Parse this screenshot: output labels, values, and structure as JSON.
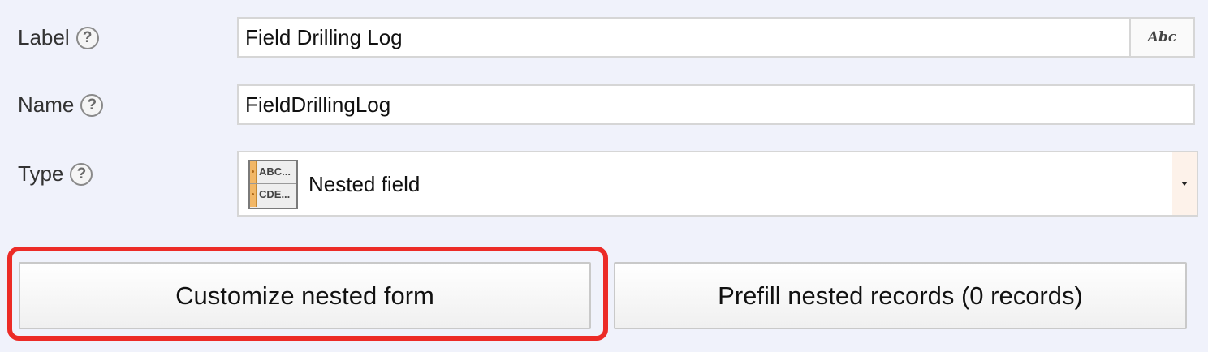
{
  "fields": {
    "label": {
      "caption": "Label",
      "value": "Field Drilling Log",
      "abc_button": "Abc"
    },
    "name": {
      "caption": "Name",
      "value": "FieldDrillingLog"
    },
    "type": {
      "caption": "Type",
      "value": "Nested field",
      "icon_rows": [
        "ABC...",
        "CDE..."
      ]
    }
  },
  "help_glyph": "?",
  "buttons": {
    "customize": "Customize nested form",
    "prefill": "Prefill nested records (0 records)"
  },
  "colors": {
    "highlight": "#ec2b27",
    "background": "#f0f2fb"
  }
}
